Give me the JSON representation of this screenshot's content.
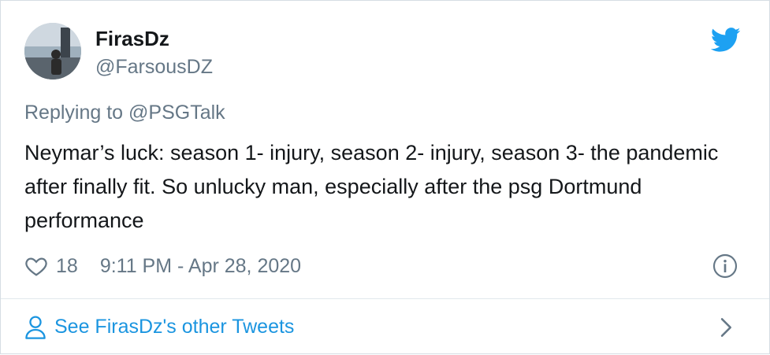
{
  "tweet": {
    "author": {
      "display_name": "FirasDz",
      "handle": "@FarsousDZ",
      "avatar_icon": "profile-photo",
      "platform_icon": "twitter-bird-icon"
    },
    "reply": {
      "prefix": "Replying to ",
      "mention": "@PSGTalk"
    },
    "text": "Neymar’s luck: season 1- injury, season 2- injury, season 3- the pandemic after finally fit. So unlucky man, especially after the psg Dortmund performance",
    "likes": "18",
    "timestamp": "9:11 PM - Apr 28, 2020"
  },
  "footer": {
    "link_label": "See FirasDz's other Tweets"
  },
  "colors": {
    "brand_blue": "#1da1f2",
    "link_blue": "#1b95e0",
    "secondary_text": "#657786",
    "primary_text": "#14171a"
  }
}
